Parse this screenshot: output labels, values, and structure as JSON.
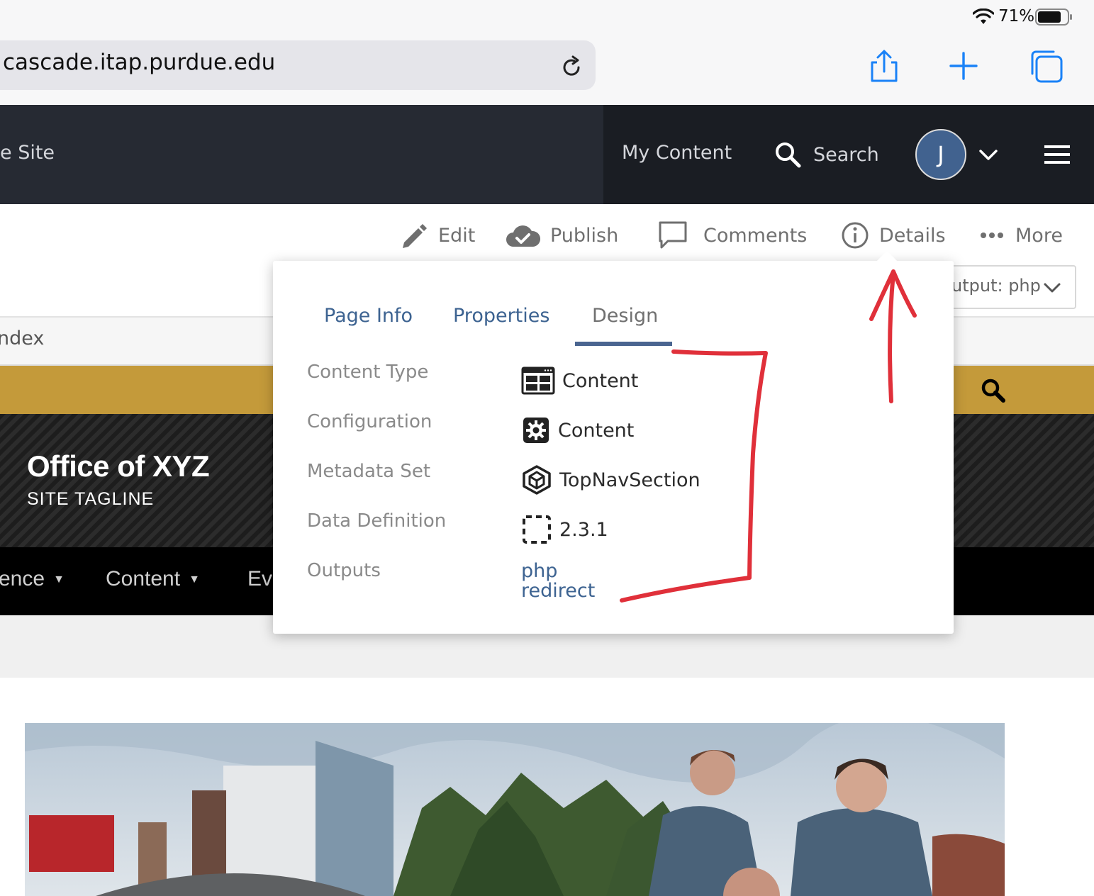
{
  "status_bar": {
    "battery": "71%"
  },
  "browser": {
    "url": "cascade.itap.purdue.edu"
  },
  "cms_bar": {
    "site_label": "e Site",
    "my_content": "My Content",
    "search": "Search",
    "avatar_initial": "J"
  },
  "actions": {
    "edit": "Edit",
    "publish": "Publish",
    "comments": "Comments",
    "details": "Details",
    "more": "More",
    "output_select": "utput: php"
  },
  "path": "ndex",
  "site": {
    "title": "Office of XYZ",
    "tagline": "SITE TAGLINE",
    "nav": [
      {
        "label": "ence"
      },
      {
        "label": "Content"
      },
      {
        "label": "Ev"
      }
    ]
  },
  "details": {
    "tabs": [
      "Page Info",
      "Properties",
      "Design"
    ],
    "active_tab": "Design",
    "rows": [
      {
        "label": "Content Type",
        "value": "Content",
        "icon": "content-type-icon"
      },
      {
        "label": "Configuration",
        "value": "Content",
        "icon": "gear-icon"
      },
      {
        "label": "Metadata Set",
        "value": "TopNavSection",
        "icon": "cube-icon"
      },
      {
        "label": "Data Definition",
        "value": "2.3.1",
        "icon": "dashed-box-icon"
      },
      {
        "label": "Outputs",
        "links": [
          "php",
          "redirect"
        ]
      }
    ]
  },
  "colors": {
    "cms_bar": "#262a33",
    "cms_bar_right": "#1a1d23",
    "purdue_gold": "#c49a3a",
    "link_blue": "#3d6391",
    "annotation_red": "#e0303a",
    "ios_blue": "#1a82f7"
  }
}
